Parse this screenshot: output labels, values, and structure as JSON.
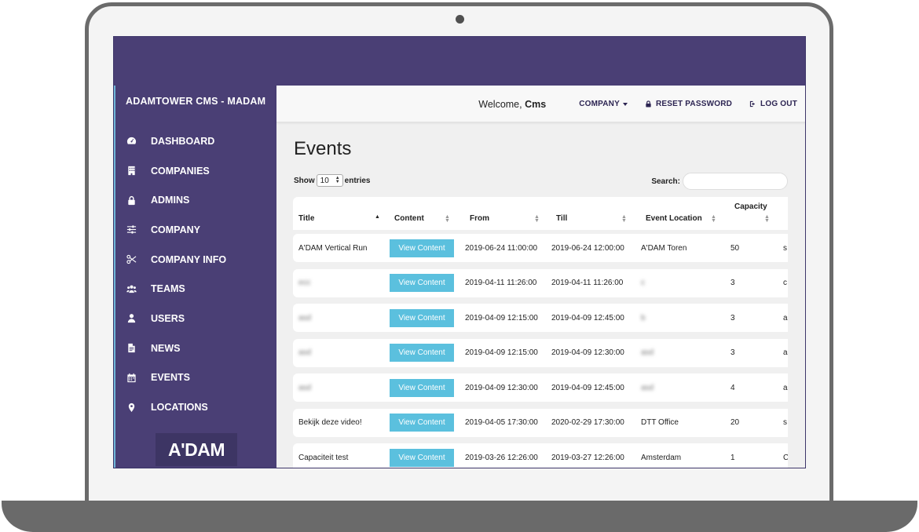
{
  "brand": "ADAMTOWER CMS - MADAM",
  "logo_text": "A'DAM",
  "sidebar": {
    "items": [
      {
        "label": "DASHBOARD",
        "icon": "dashboard-icon"
      },
      {
        "label": "COMPANIES",
        "icon": "building-icon"
      },
      {
        "label": "ADMINS",
        "icon": "lock-icon"
      },
      {
        "label": "COMPANY",
        "icon": "sliders-icon"
      },
      {
        "label": "COMPANY INFO",
        "icon": "scissors-icon"
      },
      {
        "label": "TEAMS",
        "icon": "users-group-icon"
      },
      {
        "label": "USERS",
        "icon": "user-icon"
      },
      {
        "label": "NEWS",
        "icon": "file-icon"
      },
      {
        "label": "EVENTS",
        "icon": "calendar-icon"
      },
      {
        "label": "LOCATIONS",
        "icon": "map-pin-icon"
      }
    ]
  },
  "header": {
    "welcome_prefix": "Welcome,",
    "welcome_user": "Cms",
    "company_label": "COMPANY",
    "reset_password_label": "RESET PASSWORD",
    "logout_label": "LOG OUT"
  },
  "main": {
    "title": "Events",
    "show_label": "Show",
    "entries_value": "10",
    "entries_label": "entries",
    "search_label": "Search:",
    "search_value": ""
  },
  "table": {
    "columns": [
      "Title",
      "Content",
      "From",
      "Till",
      "Event Location",
      "Capacity"
    ],
    "button_label": "View Content",
    "rows": [
      {
        "title": "A'DAM Vertical Run",
        "from": "2019-06-24 11:00:00",
        "till": "2019-06-24 12:00:00",
        "location": "A'DAM Toren",
        "capacity": "50",
        "extra": "s",
        "blur_title": false,
        "blur_location": false
      },
      {
        "title": "ecc",
        "from": "2019-04-11 11:26:00",
        "till": "2019-04-11 11:26:00",
        "location": "c",
        "capacity": "3",
        "extra": "c",
        "blur_title": true,
        "blur_location": true
      },
      {
        "title": "asd",
        "from": "2019-04-09 12:15:00",
        "till": "2019-04-09 12:45:00",
        "location": "b",
        "capacity": "3",
        "extra": "a",
        "blur_title": true,
        "blur_location": true
      },
      {
        "title": "asd",
        "from": "2019-04-09 12:15:00",
        "till": "2019-04-09 12:30:00",
        "location": "asd",
        "capacity": "3",
        "extra": "a",
        "blur_title": true,
        "blur_location": true
      },
      {
        "title": "asd",
        "from": "2019-04-09 12:30:00",
        "till": "2019-04-09 12:45:00",
        "location": "asd",
        "capacity": "4",
        "extra": "a",
        "blur_title": true,
        "blur_location": true
      },
      {
        "title": "Bekijk deze video!",
        "from": "2019-04-05 17:30:00",
        "till": "2020-02-29 17:30:00",
        "location": "DTT Office",
        "capacity": "20",
        "extra": "s",
        "blur_title": false,
        "blur_location": false
      },
      {
        "title": "Capaciteit test",
        "from": "2019-03-26 12:26:00",
        "till": "2019-03-27 12:26:00",
        "location": "Amsterdam",
        "capacity": "1",
        "extra": "C",
        "blur_title": false,
        "blur_location": false
      }
    ]
  },
  "colors": {
    "brand_purple": "#4a3f75",
    "button_blue": "#5bc0de",
    "sidebar_accent": "#6fb6d8"
  }
}
